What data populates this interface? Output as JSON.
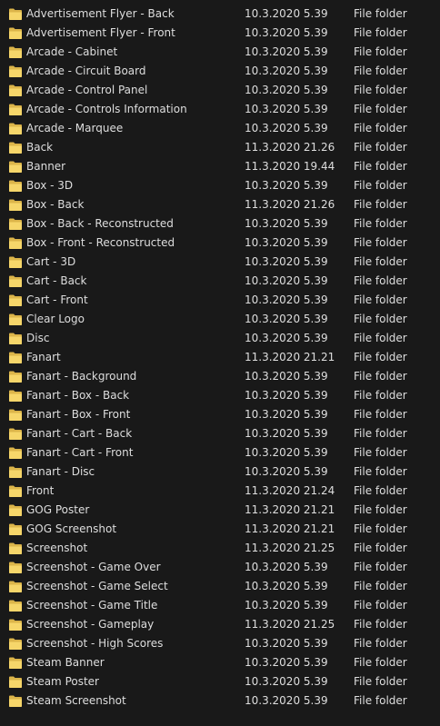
{
  "icon": "folder-icon",
  "colors": {
    "background": "#191919",
    "text": "#dedede",
    "folder_back": "#dcb54a",
    "folder_front": "#f6d66a"
  },
  "rows": [
    {
      "name": "Advertisement Flyer - Back",
      "date": "10.3.2020 5.39",
      "type": "File folder"
    },
    {
      "name": "Advertisement Flyer - Front",
      "date": "10.3.2020 5.39",
      "type": "File folder"
    },
    {
      "name": "Arcade - Cabinet",
      "date": "10.3.2020 5.39",
      "type": "File folder"
    },
    {
      "name": "Arcade - Circuit Board",
      "date": "10.3.2020 5.39",
      "type": "File folder"
    },
    {
      "name": "Arcade - Control Panel",
      "date": "10.3.2020 5.39",
      "type": "File folder"
    },
    {
      "name": "Arcade - Controls Information",
      "date": "10.3.2020 5.39",
      "type": "File folder"
    },
    {
      "name": "Arcade - Marquee",
      "date": "10.3.2020 5.39",
      "type": "File folder"
    },
    {
      "name": "Back",
      "date": "11.3.2020 21.26",
      "type": "File folder"
    },
    {
      "name": "Banner",
      "date": "11.3.2020 19.44",
      "type": "File folder"
    },
    {
      "name": "Box - 3D",
      "date": "10.3.2020 5.39",
      "type": "File folder"
    },
    {
      "name": "Box - Back",
      "date": "11.3.2020 21.26",
      "type": "File folder"
    },
    {
      "name": "Box - Back - Reconstructed",
      "date": "10.3.2020 5.39",
      "type": "File folder"
    },
    {
      "name": "Box - Front - Reconstructed",
      "date": "10.3.2020 5.39",
      "type": "File folder"
    },
    {
      "name": "Cart - 3D",
      "date": "10.3.2020 5.39",
      "type": "File folder"
    },
    {
      "name": "Cart - Back",
      "date": "10.3.2020 5.39",
      "type": "File folder"
    },
    {
      "name": "Cart - Front",
      "date": "10.3.2020 5.39",
      "type": "File folder"
    },
    {
      "name": "Clear Logo",
      "date": "10.3.2020 5.39",
      "type": "File folder"
    },
    {
      "name": "Disc",
      "date": "10.3.2020 5.39",
      "type": "File folder"
    },
    {
      "name": "Fanart",
      "date": "11.3.2020 21.21",
      "type": "File folder"
    },
    {
      "name": "Fanart - Background",
      "date": "10.3.2020 5.39",
      "type": "File folder"
    },
    {
      "name": "Fanart - Box - Back",
      "date": "10.3.2020 5.39",
      "type": "File folder"
    },
    {
      "name": "Fanart - Box - Front",
      "date": "10.3.2020 5.39",
      "type": "File folder"
    },
    {
      "name": "Fanart - Cart - Back",
      "date": "10.3.2020 5.39",
      "type": "File folder"
    },
    {
      "name": "Fanart - Cart - Front",
      "date": "10.3.2020 5.39",
      "type": "File folder"
    },
    {
      "name": "Fanart - Disc",
      "date": "10.3.2020 5.39",
      "type": "File folder"
    },
    {
      "name": "Front",
      "date": "11.3.2020 21.24",
      "type": "File folder"
    },
    {
      "name": "GOG Poster",
      "date": "11.3.2020 21.21",
      "type": "File folder"
    },
    {
      "name": "GOG Screenshot",
      "date": "11.3.2020 21.21",
      "type": "File folder"
    },
    {
      "name": "Screenshot",
      "date": "11.3.2020 21.25",
      "type": "File folder"
    },
    {
      "name": "Screenshot - Game Over",
      "date": "10.3.2020 5.39",
      "type": "File folder"
    },
    {
      "name": "Screenshot - Game Select",
      "date": "10.3.2020 5.39",
      "type": "File folder"
    },
    {
      "name": "Screenshot - Game Title",
      "date": "10.3.2020 5.39",
      "type": "File folder"
    },
    {
      "name": "Screenshot - Gameplay",
      "date": "11.3.2020 21.25",
      "type": "File folder"
    },
    {
      "name": "Screenshot - High Scores",
      "date": "10.3.2020 5.39",
      "type": "File folder"
    },
    {
      "name": "Steam Banner",
      "date": "10.3.2020 5.39",
      "type": "File folder"
    },
    {
      "name": "Steam Poster",
      "date": "10.3.2020 5.39",
      "type": "File folder"
    },
    {
      "name": "Steam Screenshot",
      "date": "10.3.2020 5.39",
      "type": "File folder"
    }
  ]
}
